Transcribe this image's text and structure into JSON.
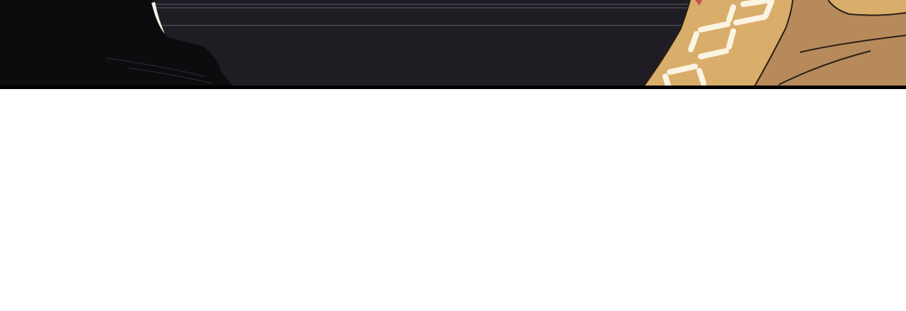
{
  "colors": {
    "background": "#ffffff",
    "wall": "#1f1c24",
    "wall_line": "#4a4652",
    "dark_figure": "#0c0b0d",
    "cloth_light": "#d9ad6a",
    "cloth_dark": "#b78a5c",
    "stitch": "#fbf4e2",
    "panel_border": "#000000"
  }
}
